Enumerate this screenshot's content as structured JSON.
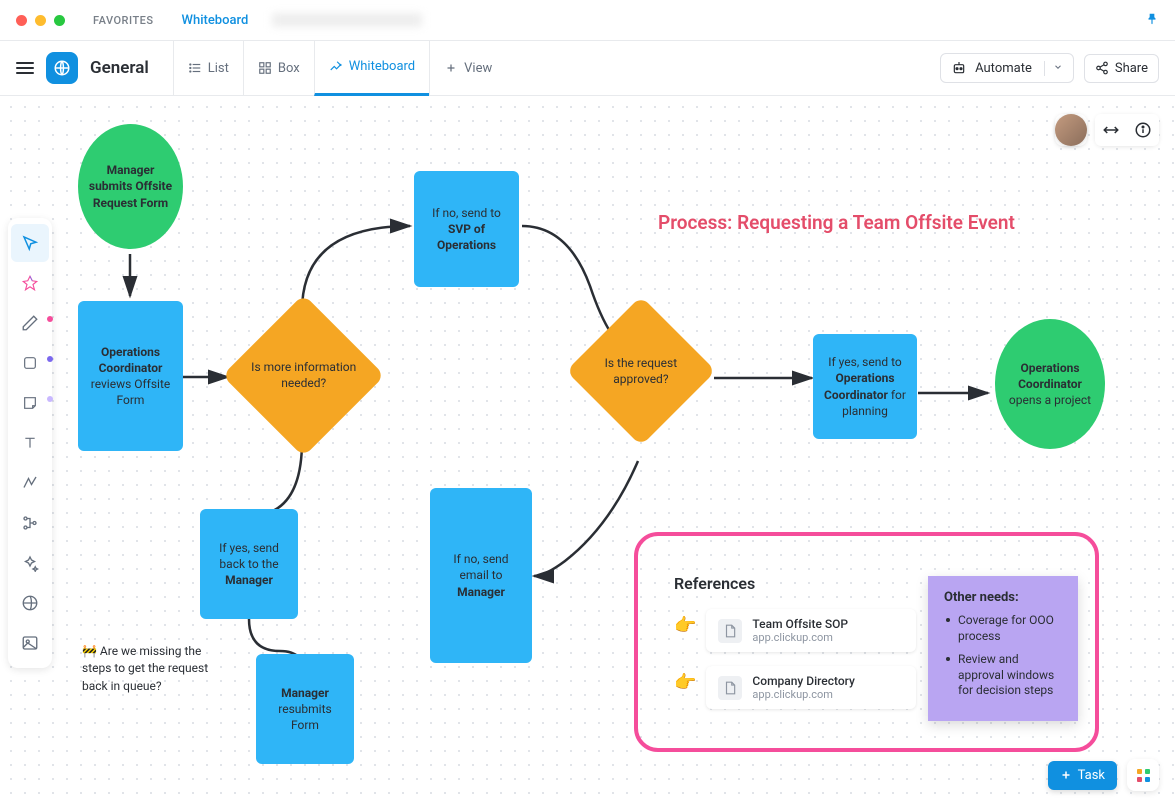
{
  "titlebar": {
    "favorites_label": "FAVORITES",
    "tab_whiteboard": "Whiteboard"
  },
  "toolbar": {
    "title": "General",
    "tabs": {
      "list": "List",
      "box": "Box",
      "whiteboard": "Whiteboard",
      "add_view": "View"
    },
    "automate": "Automate",
    "share": "Share"
  },
  "process_title": "Process: Requesting a Team Offsite Event",
  "shapes": {
    "start": {
      "line1": "Manager submits Offsite Request Form"
    },
    "review": {
      "bold": "Operations Coordinator",
      "rest": " reviews Offsite Form"
    },
    "more_info": "Is more information needed?",
    "svp": {
      "pre": "If no, send to ",
      "bold": "SVP of Operations"
    },
    "approved": "Is the request approved?",
    "send_back": {
      "pre": "If yes, send back to the ",
      "bold": "Manager"
    },
    "resubmit": {
      "bold": "Manager",
      "rest": " resubmits Form"
    },
    "email_mgr": {
      "pre": "If no, send email to ",
      "bold": "Manager"
    },
    "planning": {
      "pre": "If yes, send to ",
      "bold": "Operations Coordinator",
      "post": " for planning"
    },
    "open_project": {
      "bold": "Operations Coordinator",
      "rest": " opens a project"
    }
  },
  "comment": "🚧 Are we missing the steps to get the request back in queue?",
  "references": {
    "title": "References",
    "items": [
      {
        "title": "Team Offsite SOP",
        "sub": "app.clickup.com"
      },
      {
        "title": "Company Directory",
        "sub": "app.clickup.com"
      }
    ]
  },
  "sticky": {
    "title": "Other needs:",
    "items": [
      "Coverage for OOO process",
      "Review and approval windows for decision steps"
    ]
  },
  "task_button": "Task"
}
